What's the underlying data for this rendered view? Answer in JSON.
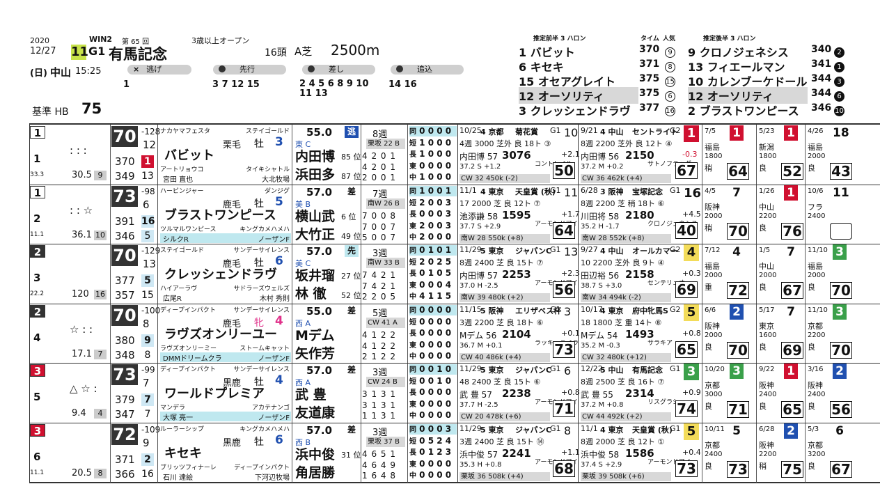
{
  "header": {
    "year": "2020",
    "date": "12/27",
    "weekday": "(日)",
    "course": "中山",
    "time": "15:25",
    "race_number": "11",
    "win_tag": "WIN2",
    "edition": "第 65 回",
    "grade": "G1",
    "race_name": "有馬記念",
    "conditions": "3歳以上オープン",
    "field_size": "16頭",
    "weight_rule": "A芝",
    "distance": "2500m",
    "baseline_label": "基準 HB",
    "baseline_value": "75"
  },
  "styles": [
    {
      "label": "逃げ",
      "symbol": "×",
      "horses": "1"
    },
    {
      "label": "先行",
      "symbol": "O",
      "horses": "3 7 12 15"
    },
    {
      "label": "差し",
      "symbol": "O",
      "horses": "2 4 5 6 8 9 10 11 13"
    },
    {
      "label": "追込",
      "symbol": "O",
      "horses": "14 16"
    }
  ],
  "rankings": {
    "front_title": "推定前半 3 ハロン",
    "time_label": "タイム",
    "pop_label": "人気",
    "back_title": "推定後半 3 ハロン",
    "front": [
      {
        "no": "1",
        "name": "バビット",
        "time": "370",
        "rank": "9"
      },
      {
        "no": "6",
        "name": "キセキ",
        "time": "371",
        "rank": "8"
      },
      {
        "no": "15",
        "name": "オセアグレイト",
        "time": "375",
        "rank": "15"
      },
      {
        "no": "12",
        "name": "オーソリティ",
        "time": "375",
        "rank": "6"
      },
      {
        "no": "3",
        "name": "クレッシェンドラヴ",
        "time": "377",
        "rank": "16"
      }
    ],
    "back": [
      {
        "no": "9",
        "name": "クロノジェネシス",
        "time": "340",
        "rank": "2"
      },
      {
        "no": "13",
        "name": "フィエールマン",
        "time": "341",
        "rank": "1"
      },
      {
        "no": "10",
        "name": "カレンブーケドール",
        "time": "344",
        "rank": "3"
      },
      {
        "no": "12",
        "name": "オーソリティ",
        "time": "344",
        "rank": "6"
      },
      {
        "no": "2",
        "name": "ブラストワンピース",
        "time": "346",
        "rank": "10"
      }
    ]
  },
  "horses": [
    {
      "gate": "1",
      "no": "1",
      "marks": ": : :",
      "odds": "30.5",
      "pop": "9",
      "pct": "33.3",
      "rating": "70",
      "r1": "-128",
      "r2": "12",
      "t1": "370",
      "t1b": "1",
      "t2": "349",
      "t2b": "13",
      "sire": "ナカヤマフェスタ",
      "dam_sire": "ステイゴールド",
      "coat": "栗毛",
      "sex": "牡",
      "age": "3",
      "name": "バビット",
      "dam": "アートリョウコ",
      "breeder_line": "タイキシャトル",
      "trainer": "宮田 直也",
      "farm": "大北牧場",
      "weight": "55.0",
      "style": "逃",
      "east": "東 C",
      "jockey": "内田博",
      "jockey2": "浜田多",
      "j_pos": "85 位",
      "j2_pos": "87 位",
      "stats_label": "8週",
      "course_label": "栗坂 22 B",
      "s1": "4 2 0 1",
      "s2": "4 2 0 1",
      "s3": "2 0 0 1",
      "rec": [
        "0 0 0 0",
        "1 0 0 0",
        "1 0 0 0",
        "0 0 0 0",
        "1 0 0 0"
      ]
    },
    {
      "gate": "1",
      "no": "2",
      "marks": ": : ☆",
      "odds": "36.1",
      "pop": "10",
      "pct": "11.1",
      "rating": "73",
      "r1": "-98",
      "r2": "6",
      "t1": "391",
      "t1b": "16",
      "t2": "346",
      "t2b": "5",
      "sire": "ハービンジャー",
      "dam_sire": "ダンジグ",
      "coat": "鹿毛",
      "sex": "牡",
      "age": "5",
      "name": "ブラストワンピース",
      "dam": "ツルマルワンピース",
      "breeder_line": "キングカメハメハ",
      "trainer": "シルクR",
      "farm": "ノーザンF",
      "weight": "57.0",
      "style": "差",
      "east": "美 B",
      "jockey": "横山武",
      "jockey2": "大竹正",
      "j_pos": "6 位",
      "j2_pos": "49 位",
      "stats_label": "7週",
      "course_label": "南W 26 B",
      "s1": "7 0 0 8",
      "s2": "7 0 0 7",
      "s3": "5 0 0 7",
      "rec": [
        "1 0 0 1",
        "2 0 0 3",
        "0 0 0 3",
        "2 0 0 3",
        "2 0 0 0"
      ]
    },
    {
      "gate": "2",
      "no": "3",
      "marks": "",
      "odds": "120",
      "pop": "16",
      "pct": "22.2",
      "rating": "70",
      "r1": "-129",
      "r2": "13",
      "t1": "377",
      "t1b": "5",
      "t2": "357",
      "t2b": "15",
      "sire": "ステイゴールド",
      "dam_sire": "サンデーサイレンス",
      "coat": "鹿毛",
      "sex": "牡",
      "age": "6",
      "name": "クレッシェンドラヴ",
      "dam": "ハイアーラヴ",
      "breeder_line": "サドラーズウェルズ",
      "trainer": "広尾R",
      "farm": "木村 秀則",
      "weight": "57.0",
      "style": "先",
      "east": "美 C",
      "jockey": "坂井瑠",
      "jockey2": "林 徹",
      "j_pos": "27 位",
      "j2_pos": "52 位",
      "stats_label": "3週",
      "course_label": "南W 33 B",
      "s1": "7 4 2 1",
      "s2": "7 4 2 1",
      "s3": "2 2 0 5",
      "rec": [
        "0 1 0 1",
        "2 0 2 5",
        "0 1 0 5",
        "0 0 0 4",
        "4 1 1 5"
      ]
    },
    {
      "gate": "2",
      "no": "4",
      "marks": "☆ : :",
      "odds": "17.1",
      "pop": "7",
      "pct": "",
      "rating": "70",
      "r1": "-100",
      "r2": "8",
      "t1": "380",
      "t1b": "9",
      "t2": "348",
      "t2b": "8",
      "sire": "ディープインパクト",
      "dam_sire": "サンデーサイレンス",
      "coat": "鹿毛",
      "sex": "牝",
      "age": "4",
      "name": "ラヴズオンリーユー",
      "dam": "ラヴズオンリーミー",
      "breeder_line": "ストームキャット",
      "trainer": "DMMドリームクラ",
      "farm": "ノーザンF",
      "weight": "55.0",
      "style": "差",
      "east": "西 A",
      "jockey": "Mデム",
      "jockey2": "矢作芳",
      "j_pos": "",
      "j2_pos": "",
      "stats_label": "5週",
      "course_label": "CW 41 A",
      "s1": "4 1 2 2",
      "s2": "4 1 2 2",
      "s3": "2 1 2 2",
      "rec": [
        "0 0 0 0",
        "0 0 0 0",
        "0 0 0 0",
        "0 0 0 0",
        "0 0 0 0"
      ]
    },
    {
      "gate": "3",
      "no": "5",
      "marks": "△ ☆ :",
      "odds": "9.4",
      "pop": "4",
      "pct": "",
      "rating": "73",
      "r1": "-99",
      "r2": "7",
      "t1": "379",
      "t1b": "7",
      "t2": "347",
      "t2b": "7",
      "sire": "ディープインパクト",
      "dam_sire": "サンデーサイレンス",
      "coat": "黒鹿",
      "sex": "牡",
      "age": "4",
      "name": "ワールドプレミア",
      "dam": "マンデラ",
      "breeder_line": "アカテナンゴ",
      "trainer": "大塚 亮一",
      "farm": "ノーザンF",
      "weight": "57.0",
      "style": "差",
      "east": "西 A",
      "jockey": "武 豊",
      "jockey2": "友道康",
      "j_pos": "",
      "j2_pos": "",
      "stats_label": "3週",
      "course_label": "CW 24 B",
      "s1": "3 1 3 1",
      "s2": "3 1 3 1",
      "s3": "1 1 3 1",
      "rec": [
        "0 0 1 0",
        "0 0 1 0",
        "0 0 0 0",
        "0 0 0 0",
        "0 0 0 0"
      ]
    },
    {
      "gate": "3",
      "no": "6",
      "marks": "",
      "odds": "20.5",
      "pop": "8",
      "pct": "11.1",
      "rating": "72",
      "r1": "-109",
      "r2": "9",
      "t1": "371",
      "t1b": "2",
      "t2": "366",
      "t2b": "16",
      "sire": "ルーラーシップ",
      "dam_sire": "キングカメハメハ",
      "coat": "黒鹿",
      "sex": "牡",
      "age": "6",
      "name": "キセキ",
      "dam": "ブリッツフィナーレ",
      "breeder_line": "ディープインパクト",
      "trainer": "石川 達絵",
      "farm": "下河辺牧場",
      "weight": "57.0",
      "style": "差",
      "east": "西 B",
      "jockey": "浜中俊",
      "jockey2": "角居勝",
      "j_pos": "31 位",
      "j2_pos": "",
      "stats_label": "3週",
      "course_label": "栗坂 37 B",
      "s1": "4 6 5 1",
      "s2": "4 6 4 9",
      "s3": "1 6 4 8",
      "rec": [
        "0 0 0 3",
        "0 5 2 4",
        "0 1 2 3",
        "0 0 0 0",
        "0 0 0 0"
      ]
    }
  ],
  "last_race": [
    {
      "date": "10/25",
      "course": "4 京都",
      "day": "6",
      "race": "菊花賞",
      "grade": "G1",
      "field": "10",
      "info": "4週 3000 芝外 良 18ト ③",
      "jockey": "内田博 57",
      "time": "3076",
      "wt": "6",
      "pos": "11",
      "diff": "+2.1",
      "rival": "コントレイル",
      "pace": "37.2 S +1.2",
      "score": "50",
      "bd": "CW 32 450k (-2)"
    },
    {
      "date": "11/1",
      "course": "4 東京",
      "day": "8",
      "race": "天皇賞 (秋)",
      "grade": "G1",
      "field": "11",
      "info": "17 2000 芝 良 12ト ⑦",
      "jockey": "池添謙 58",
      "time": "1595",
      "wt": "1",
      "pos": "11",
      "diff": "+1.7",
      "rival": "アーモンドアイ",
      "pace": "37.7 S +2.9",
      "score": "64",
      "bd": "南W 28 550k (+8)"
    },
    {
      "date": "11/29",
      "course": "5 東京",
      "day": "9",
      "race": "ジャパンC",
      "grade": "G1",
      "field": "13",
      "info": "8週 2400 芝 良 15ト ⑦",
      "jockey": "内田博 57",
      "time": "2253",
      "wt": "6",
      "pos": "11",
      "diff": "+2.3",
      "rival": "アーモンドアイ",
      "pace": "37.0 H -2.5",
      "score": "56",
      "bd": "南W 39 480k (+2)"
    },
    {
      "date": "11/15",
      "course": "5 阪神",
      "day": "4",
      "race": "エリザベス杯",
      "grade": "G1",
      "field": "3",
      "info": "3週 2200 芝 良 18ト ⑥",
      "jockey": "Mデム 56",
      "time": "2104",
      "wt": "6",
      "pos": "11",
      "diff": "+0.1",
      "rival": "ラッキーライラ",
      "pace": "36.7 M +0.1",
      "score": "73",
      "bd": "CW 40 486k (+4)"
    },
    {
      "date": "11/29",
      "course": "5 東京",
      "day": "9",
      "race": "ジャパンC",
      "grade": "G1",
      "field": "6",
      "info": "48 2400 芝 良 15ト ⑥",
      "jockey": "武 豊 57",
      "time": "2238",
      "wt": "2",
      "pos": "3",
      "diff": "+0.8",
      "rival": "アーモンドアイ",
      "pace": "37.7 H -2.5",
      "score": "71",
      "bd": "CW 20 478k (+6)"
    },
    {
      "date": "11/29",
      "course": "5 東京",
      "day": "9",
      "race": "ジャパンC",
      "grade": "G1",
      "field": "8",
      "info": "3週 2400 芝 良 15ト ⑭",
      "jockey": "浜中俊 57",
      "time": "2241",
      "wt": "3",
      "pos": "4",
      "diff": "+1.1",
      "rival": "アーモンドアイ",
      "pace": "35.3 H +0.8",
      "score": "68",
      "bd": "栗坂 36 508k (+4)"
    }
  ],
  "prev_race": [
    {
      "date": "9/21",
      "course": "4 中山",
      "day": "5",
      "race": "セントライト",
      "grade": "G2",
      "rank": "1",
      "info": "8週 2200 芝外 良 12ト ④",
      "jockey": "内田博 56",
      "time": "2150",
      "diff": "-0.3",
      "rival": "サトノフラッグ",
      "pace": "37.2 M +0.2",
      "score": "67",
      "bd": "CW 36 462k (+4)"
    },
    {
      "date": "6/28",
      "course": "3 阪神",
      "day": "8",
      "race": "宝塚記念",
      "grade": "G1",
      "rank": "16",
      "info": "8週 2200 芝 稍 18ト ⑥",
      "jockey": "川田将 58",
      "time": "2180",
      "diff": "+4.5",
      "rival": "クロノジェネシス",
      "pace": "35.2 H -1.7",
      "score": "40",
      "bd": "南W 28 552k (+8)"
    },
    {
      "date": "9/27",
      "course": "4 中山",
      "day": "7",
      "race": "オールカマー",
      "grade": "G2",
      "rank": "4",
      "info": "10 2200 芝外 良 9ト ④",
      "jockey": "田辺裕 56",
      "time": "2158",
      "diff": "+0.3",
      "rival": "センテリュオ",
      "pace": "38.7 S +3.0",
      "score": "69",
      "bd": "南W 34 494k (-2)"
    },
    {
      "date": "10/17",
      "course": "4 東京",
      "day": "3",
      "race": "府中牝馬S",
      "grade": "G2",
      "rank": "5",
      "info": "18 1800 芝 重 14ト ⑧",
      "jockey": "Mデム 54",
      "time": "1493",
      "diff": "+0.8",
      "rival": "サラキア",
      "pace": "35.2 M -0.3",
      "score": "65",
      "bd": "CW 32 480k (+12)"
    },
    {
      "date": "12/22",
      "course": "5 中山",
      "day": "8",
      "race": "有馬記念",
      "grade": "G1",
      "rank": "3",
      "info": "8週 2500 芝 良 16ト ⑦",
      "jockey": "武 豊 55",
      "time": "2314",
      "diff": "+0.9",
      "rival": "リスグラシュー",
      "pace": "37.2 M +0.8",
      "score": "74",
      "bd": "CW 44 492k (+2)"
    },
    {
      "date": "11/1",
      "course": "4 東京",
      "day": "8",
      "race": "天皇賞 (秋)",
      "grade": "G1",
      "rank": "5",
      "info": "8週 2000 芝 良 12ト ①",
      "jockey": "浜中俊 58",
      "time": "1586",
      "diff": "+0.4",
      "rival": "アーモンドアイ",
      "pace": "37.4 S +2.9",
      "score": "73",
      "bd": "栗坂 39 508k (+6)"
    }
  ],
  "history": [
    [
      {
        "d": "7/5",
        "r": "1",
        "p": "福島",
        "c": "1800",
        "g": "稍",
        "s": "64"
      },
      {
        "d": "5/23",
        "r": "1",
        "p": "新潟",
        "c": "1800",
        "g": "良",
        "s": "52"
      },
      {
        "d": "4/26",
        "r": "18",
        "p": "福島",
        "c": "2000",
        "g": "良",
        "s": "43"
      }
    ],
    [
      {
        "d": "4/5",
        "r": "7",
        "p": "阪神",
        "c": "2000",
        "g": "稍",
        "s": "70"
      },
      {
        "d": "1/26",
        "r": "1",
        "p": "中山",
        "c": "2200",
        "g": "良",
        "s": "76"
      },
      {
        "d": "10/6",
        "r": "11",
        "p": "フラ",
        "c": "2400",
        "g": "",
        "s": ""
      }
    ],
    [
      {
        "d": "7/12",
        "r": "4",
        "p": "福島",
        "c": "2000",
        "g": "重",
        "s": "72"
      },
      {
        "d": "1/5",
        "r": "7",
        "p": "中山",
        "c": "2000",
        "g": "良",
        "s": "67"
      },
      {
        "d": "11/10",
        "r": "3",
        "p": "福島",
        "c": "2000",
        "g": "良",
        "s": "70"
      }
    ],
    [
      {
        "d": "6/6",
        "r": "2",
        "p": "阪神",
        "c": "2000",
        "g": "良",
        "s": "70"
      },
      {
        "d": "5/17",
        "r": "7",
        "p": "東京",
        "c": "1600",
        "g": "良",
        "s": "69"
      },
      {
        "d": "11/10",
        "r": "3",
        "p": "京都",
        "c": "2200",
        "g": "良",
        "s": "70"
      }
    ],
    [
      {
        "d": "10/20",
        "r": "3",
        "p": "京都",
        "c": "3000",
        "g": "良",
        "s": "71"
      },
      {
        "d": "9/22",
        "r": "1",
        "p": "阪神",
        "c": "2400",
        "g": "良",
        "s": "65"
      },
      {
        "d": "3/16",
        "r": "2",
        "p": "阪神",
        "c": "2400",
        "g": "良",
        "s": "56"
      }
    ],
    [
      {
        "d": "10/11",
        "r": "5",
        "p": "京都",
        "c": "2400",
        "g": "良",
        "s": "73"
      },
      {
        "d": "6/28",
        "r": "2",
        "p": "阪神",
        "c": "2200",
        "g": "稍",
        "s": "75"
      },
      {
        "d": "5/3",
        "r": "6",
        "p": "京都",
        "c": "3200",
        "g": "良",
        "s": "67"
      }
    ]
  ],
  "colors": {
    "red": "#d01030",
    "cyan": "#bfe8ef",
    "dark": "#333333",
    "yellow": "#f3dc5a",
    "green": "#3aa04a",
    "blue": "#2050b0",
    "pink": "#e0308a"
  }
}
